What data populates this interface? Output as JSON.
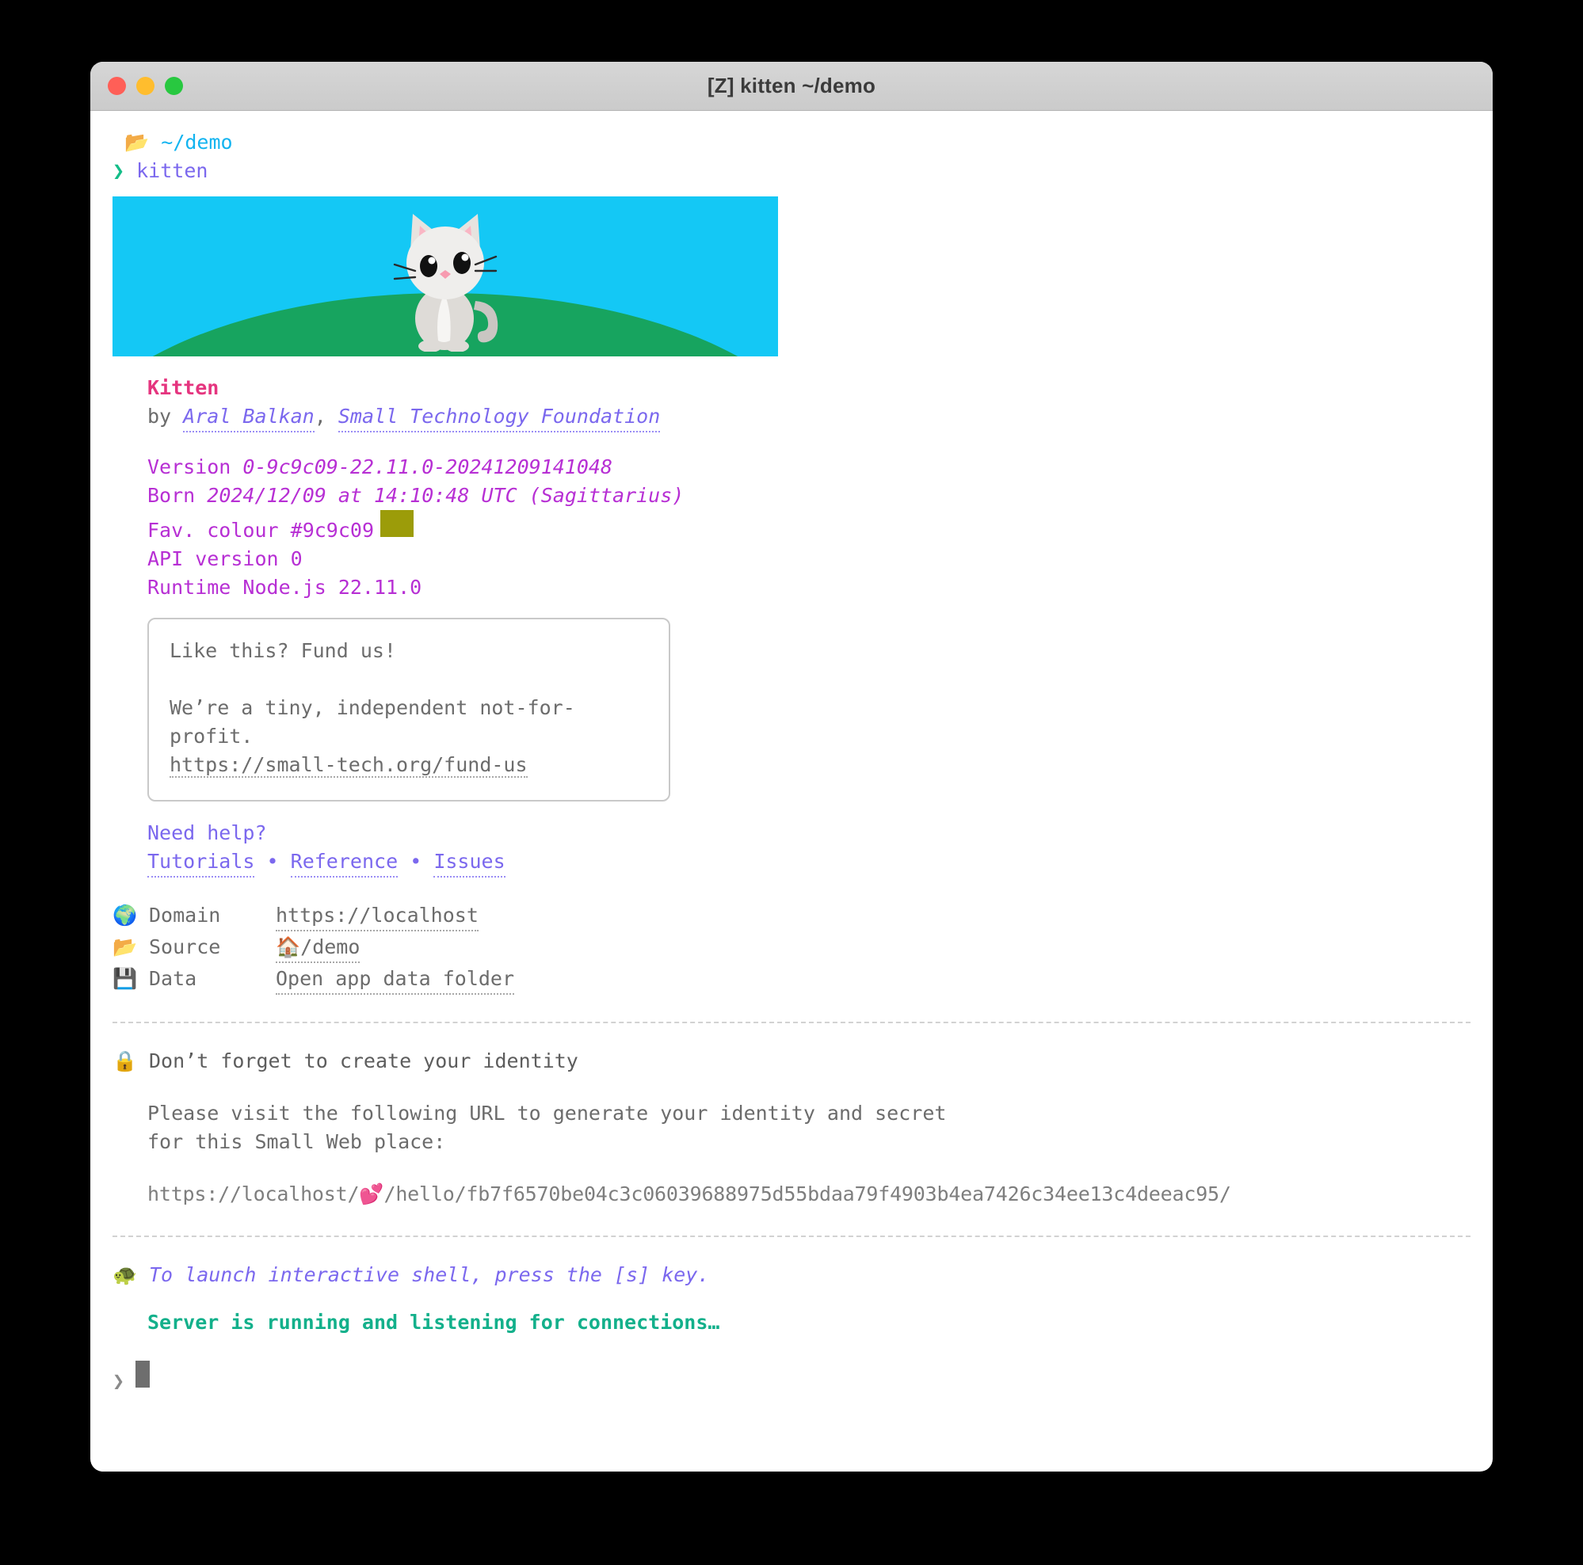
{
  "window": {
    "title": "[Z] kitten ~/demo",
    "traffic_lights": [
      "close",
      "minimise",
      "zoom"
    ]
  },
  "prompt": {
    "apple_icon": "",
    "folder_icon": "📂",
    "cwd": "~/demo",
    "arrow": "❯",
    "command": "kitten"
  },
  "banner": {
    "alt": "white kitten sitting on a green hill under a blue sky",
    "sky_color": "#14c8f5",
    "hill_color": "#17a45f"
  },
  "app": {
    "name": "Kitten",
    "by_label": "by",
    "authors": [
      "Aral Balkan",
      "Small Technology Foundation"
    ],
    "author_separator": ", "
  },
  "meta": [
    {
      "key": "Version",
      "value": "0-9c9c09-22.11.0-20241209141048"
    },
    {
      "key": "Born",
      "value": "2024/12/09 at 14:10:48 UTC (Sagittarius)"
    },
    {
      "key": "Fav. colour",
      "value": "#9c9c09",
      "swatch": "#9c9c09"
    },
    {
      "key": "API version",
      "value": "0"
    },
    {
      "key": "Runtime",
      "value": "Node.js 22.11.0"
    }
  ],
  "fund_box": {
    "heading": "Like this? Fund us!",
    "body": "We’re a tiny, independent not-for-profit.",
    "url": "https://small-tech.org/fund-us"
  },
  "help": {
    "heading": "Need help?",
    "separator": "•",
    "links": [
      "Tutorials",
      "Reference",
      "Issues"
    ]
  },
  "locations": [
    {
      "icon": "🌍",
      "icon_name": "globe-icon",
      "key": "Domain",
      "value": "https://localhost"
    },
    {
      "icon": "📂",
      "icon_name": "folder-icon",
      "key": "Source",
      "value_icon": "🏠",
      "value": "/demo"
    },
    {
      "icon": "💾",
      "icon_name": "floppy-icon",
      "key": "Data",
      "value": "Open app data folder"
    }
  ],
  "identity": {
    "icon": "🔒",
    "heading": "Don’t forget to create your identity",
    "body_line1": "Please visit the following URL to generate your identity and secret",
    "body_line2": "for this Small Web place:",
    "url_prefix": "https://localhost/",
    "url_emoji": "💕",
    "url_suffix": "/hello/fb7f6570be04c3c06039688975d55bdaa79f4903b4ea7426c34ee13c4deeac95/"
  },
  "footer": {
    "icon": "🐢",
    "shell_tip": "To launch interactive shell, press the [s] key.",
    "server_status": "Server is running and listening for connections…"
  },
  "input": {
    "arrow": "❯",
    "value": "",
    "cursor": "block"
  }
}
